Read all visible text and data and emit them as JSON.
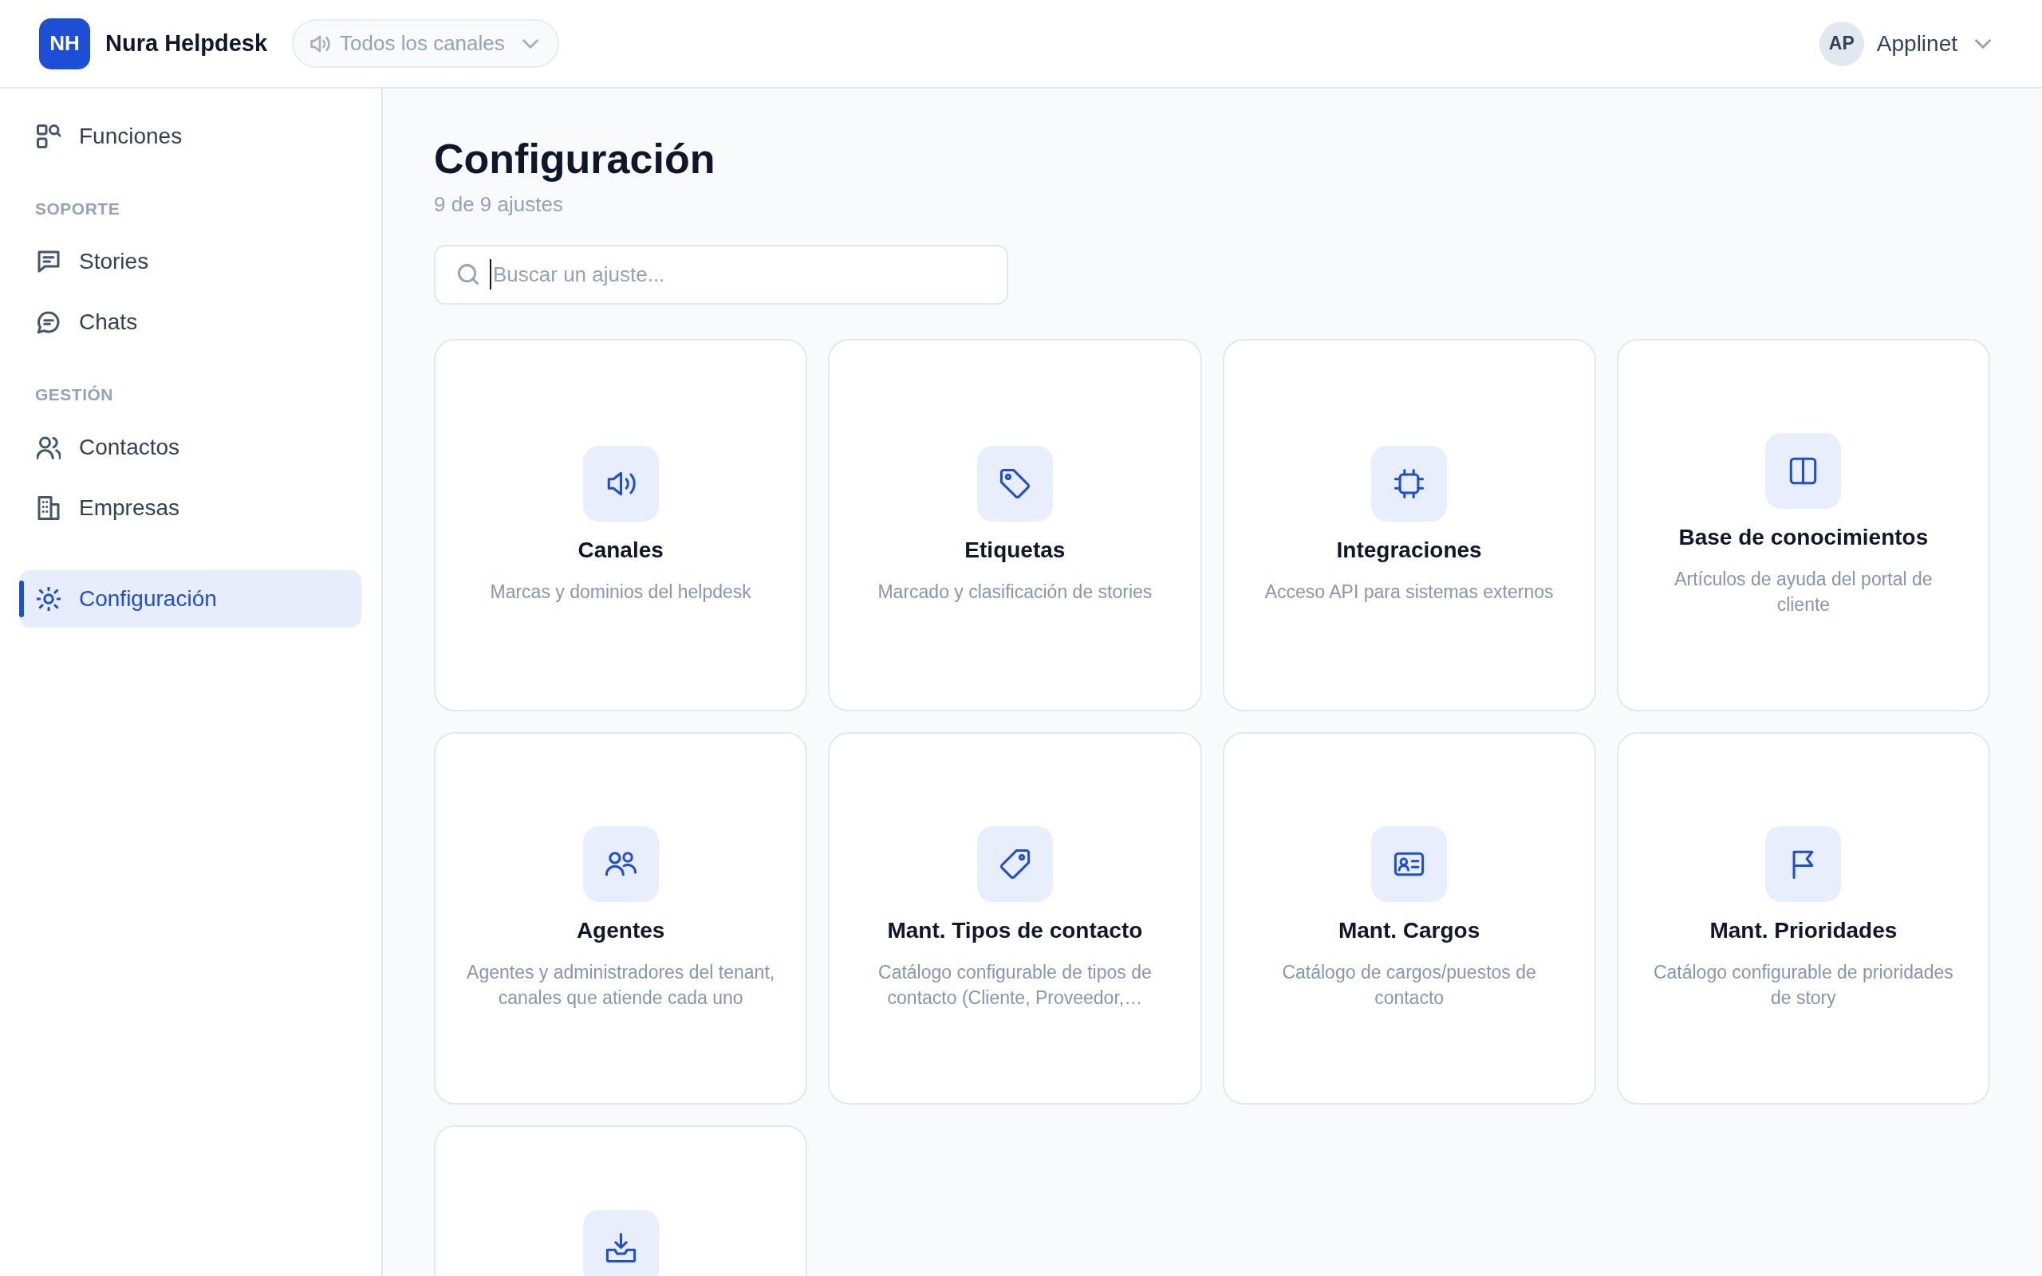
{
  "top_bar": {
    "logo": {
      "initials": "NH",
      "name": "Nura Helpdesk"
    },
    "channel_filter": {
      "label": "Todos los canales"
    },
    "user": {
      "initials": "AP",
      "name": "Applinet"
    }
  },
  "sidebar": {
    "groups": [
      {
        "items": [
          {
            "label": "Funciones",
            "selected": false
          }
        ]
      },
      {
        "heading": "SOPORTE",
        "items": [
          {
            "label": "Stories",
            "selected": false
          },
          {
            "label": "Chats",
            "selected": false
          }
        ]
      },
      {
        "heading": "GESTIÓN",
        "items": [
          {
            "label": "Contactos",
            "selected": false
          },
          {
            "label": "Empresas",
            "selected": false
          }
        ]
      },
      {
        "items": [
          {
            "label": "Configuración",
            "selected": true
          }
        ]
      }
    ]
  },
  "page": {
    "title": "Configuración",
    "subtitle": "9 de 9 ajustes",
    "search": {
      "placeholder": "Buscar un ajuste...",
      "focused": true
    },
    "cards": [
      {
        "title": "Canales",
        "description": "Marcas y dominios del helpdesk"
      },
      {
        "title": "Etiquetas",
        "description": "Marcado y clasificación de stories"
      },
      {
        "title": "Integraciones",
        "description": "Acceso API para sistemas externos"
      },
      {
        "title": "Base de conocimientos",
        "description": "Artículos de ayuda del portal de cliente"
      },
      {
        "title": "Agentes",
        "description": "Agentes y administradores del tenant, canales que atiende cada uno"
      },
      {
        "title": "Mant. Tipos de contacto",
        "description": "Catálogo configurable de tipos de contacto (Cliente, Proveedor,…"
      },
      {
        "title": "Mant. Cargos",
        "description": "Catálogo de cargos/puestos de contacto"
      },
      {
        "title": "Mant. Prioridades",
        "description": "Catálogo configurable de prioridades de story"
      }
    ],
    "card_cut_off_below": true
  }
}
